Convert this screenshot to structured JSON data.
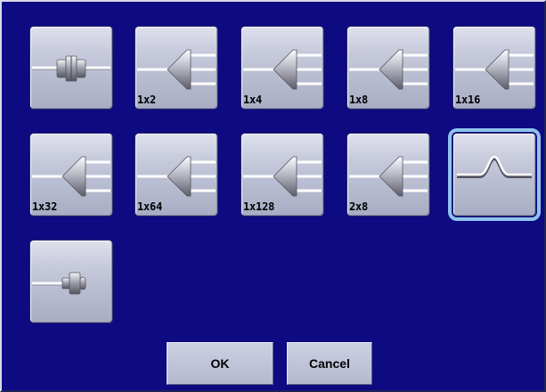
{
  "tiles": [
    {
      "icon": "connector-icon",
      "label": ""
    },
    {
      "icon": "splitter-icon",
      "label": "1x2"
    },
    {
      "icon": "splitter-icon",
      "label": "1x4"
    },
    {
      "icon": "splitter-icon",
      "label": "1x8"
    },
    {
      "icon": "splitter-icon",
      "label": "1x16"
    },
    {
      "icon": "splitter-icon",
      "label": "1x32"
    },
    {
      "icon": "splitter-icon",
      "label": "1x64"
    },
    {
      "icon": "splitter-icon",
      "label": "1x128"
    },
    {
      "icon": "splitter-icon",
      "label": "2x8"
    },
    {
      "icon": "macrobend-icon",
      "label": "",
      "selected": true
    },
    {
      "icon": "terminator-icon",
      "label": ""
    }
  ],
  "buttons": {
    "ok_label": "OK",
    "cancel_label": "Cancel"
  },
  "colors": {
    "background": "#0d0a82",
    "selection_outline": "#8ec3ec"
  }
}
